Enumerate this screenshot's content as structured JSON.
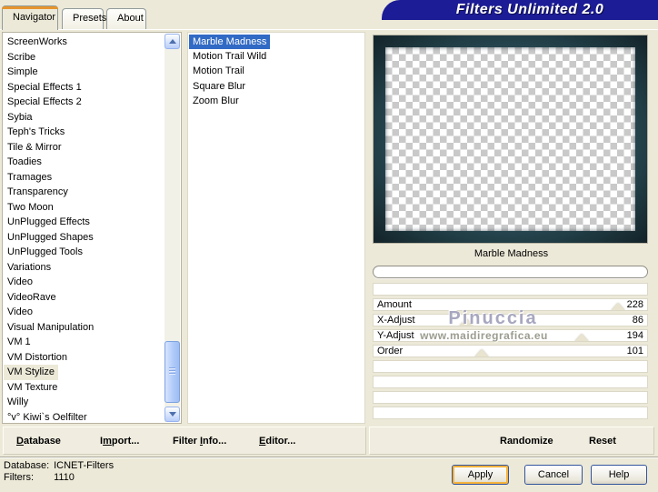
{
  "window": {
    "title": "Filters Unlimited 2.0"
  },
  "tabs": [
    {
      "label": "Navigator",
      "active": true
    },
    {
      "label": "Presets",
      "active": false
    },
    {
      "label": "About",
      "active": false
    }
  ],
  "categories": {
    "items": [
      {
        "label": "ScreenWorks"
      },
      {
        "label": "Scribe"
      },
      {
        "label": "Simple"
      },
      {
        "label": "Special Effects 1"
      },
      {
        "label": "Special Effects 2"
      },
      {
        "label": "Sybia"
      },
      {
        "label": "Teph's Tricks"
      },
      {
        "label": "Tile & Mirror"
      },
      {
        "label": "Toadies"
      },
      {
        "label": "Tramages"
      },
      {
        "label": "Transparency"
      },
      {
        "label": "Two Moon"
      },
      {
        "label": "UnPlugged Effects"
      },
      {
        "label": "UnPlugged Shapes"
      },
      {
        "label": "UnPlugged Tools"
      },
      {
        "label": "Variations"
      },
      {
        "label": "Video"
      },
      {
        "label": "VideoRave"
      },
      {
        "label": "Video"
      },
      {
        "label": "Visual Manipulation"
      },
      {
        "label": "VM 1"
      },
      {
        "label": "VM Distortion"
      },
      {
        "label": "VM Stylize",
        "selected_inactive": true
      },
      {
        "label": "VM Texture"
      },
      {
        "label": "Willy"
      },
      {
        "label": "°v° Kiwi`s Oelfilter"
      }
    ]
  },
  "filters": {
    "items": [
      {
        "label": "Marble Madness",
        "selected": true
      },
      {
        "label": "Motion Trail Wild"
      },
      {
        "label": "Motion Trail"
      },
      {
        "label": "Square Blur"
      },
      {
        "label": "Zoom Blur"
      }
    ]
  },
  "preview": {
    "label": "Marble Madness",
    "progress_value": 0
  },
  "sliders": {
    "max": 255,
    "rows": [
      {
        "label": "",
        "value": null
      },
      {
        "label": "Amount",
        "value": 228
      },
      {
        "label": "X-Adjust",
        "value": 86
      },
      {
        "label": "Y-Adjust",
        "value": 194
      },
      {
        "label": "Order",
        "value": 101
      },
      {
        "label": "",
        "value": null
      },
      {
        "label": "",
        "value": null
      },
      {
        "label": "",
        "value": null
      },
      {
        "label": "",
        "value": null
      }
    ]
  },
  "watermark": {
    "line1": "Pinuccia",
    "line2": "www.maidiregrafica.eu"
  },
  "actions": {
    "database": {
      "label": "Database",
      "key": "D"
    },
    "import": {
      "label": "Import...",
      "key": "m"
    },
    "filter_info": {
      "label": "Filter Info...",
      "key": "I"
    },
    "editor": {
      "label": "Editor...",
      "key": "E"
    },
    "randomize": {
      "label": "Randomize",
      "key": ""
    },
    "reset": {
      "label": "Reset",
      "key": ""
    }
  },
  "status": {
    "database_label": "Database:",
    "database_value": "ICNET-Filters",
    "filters_label": "Filters:",
    "filters_value": "1110"
  },
  "dialog_buttons": {
    "apply": "Apply",
    "cancel": "Cancel",
    "help": "Help"
  },
  "icons": {
    "scroll_up": "up-triangle",
    "scroll_down": "down-triangle"
  },
  "colors": {
    "background": "#ece9d8",
    "title_navy": "#1c1c96",
    "selection_blue": "#316ac5",
    "inactive_selection": "#ece9d8",
    "tab_accent_orange": "#e5942d",
    "preview_frame_teal": "#2b4f59",
    "checker_gray": "#c9c9c9"
  }
}
